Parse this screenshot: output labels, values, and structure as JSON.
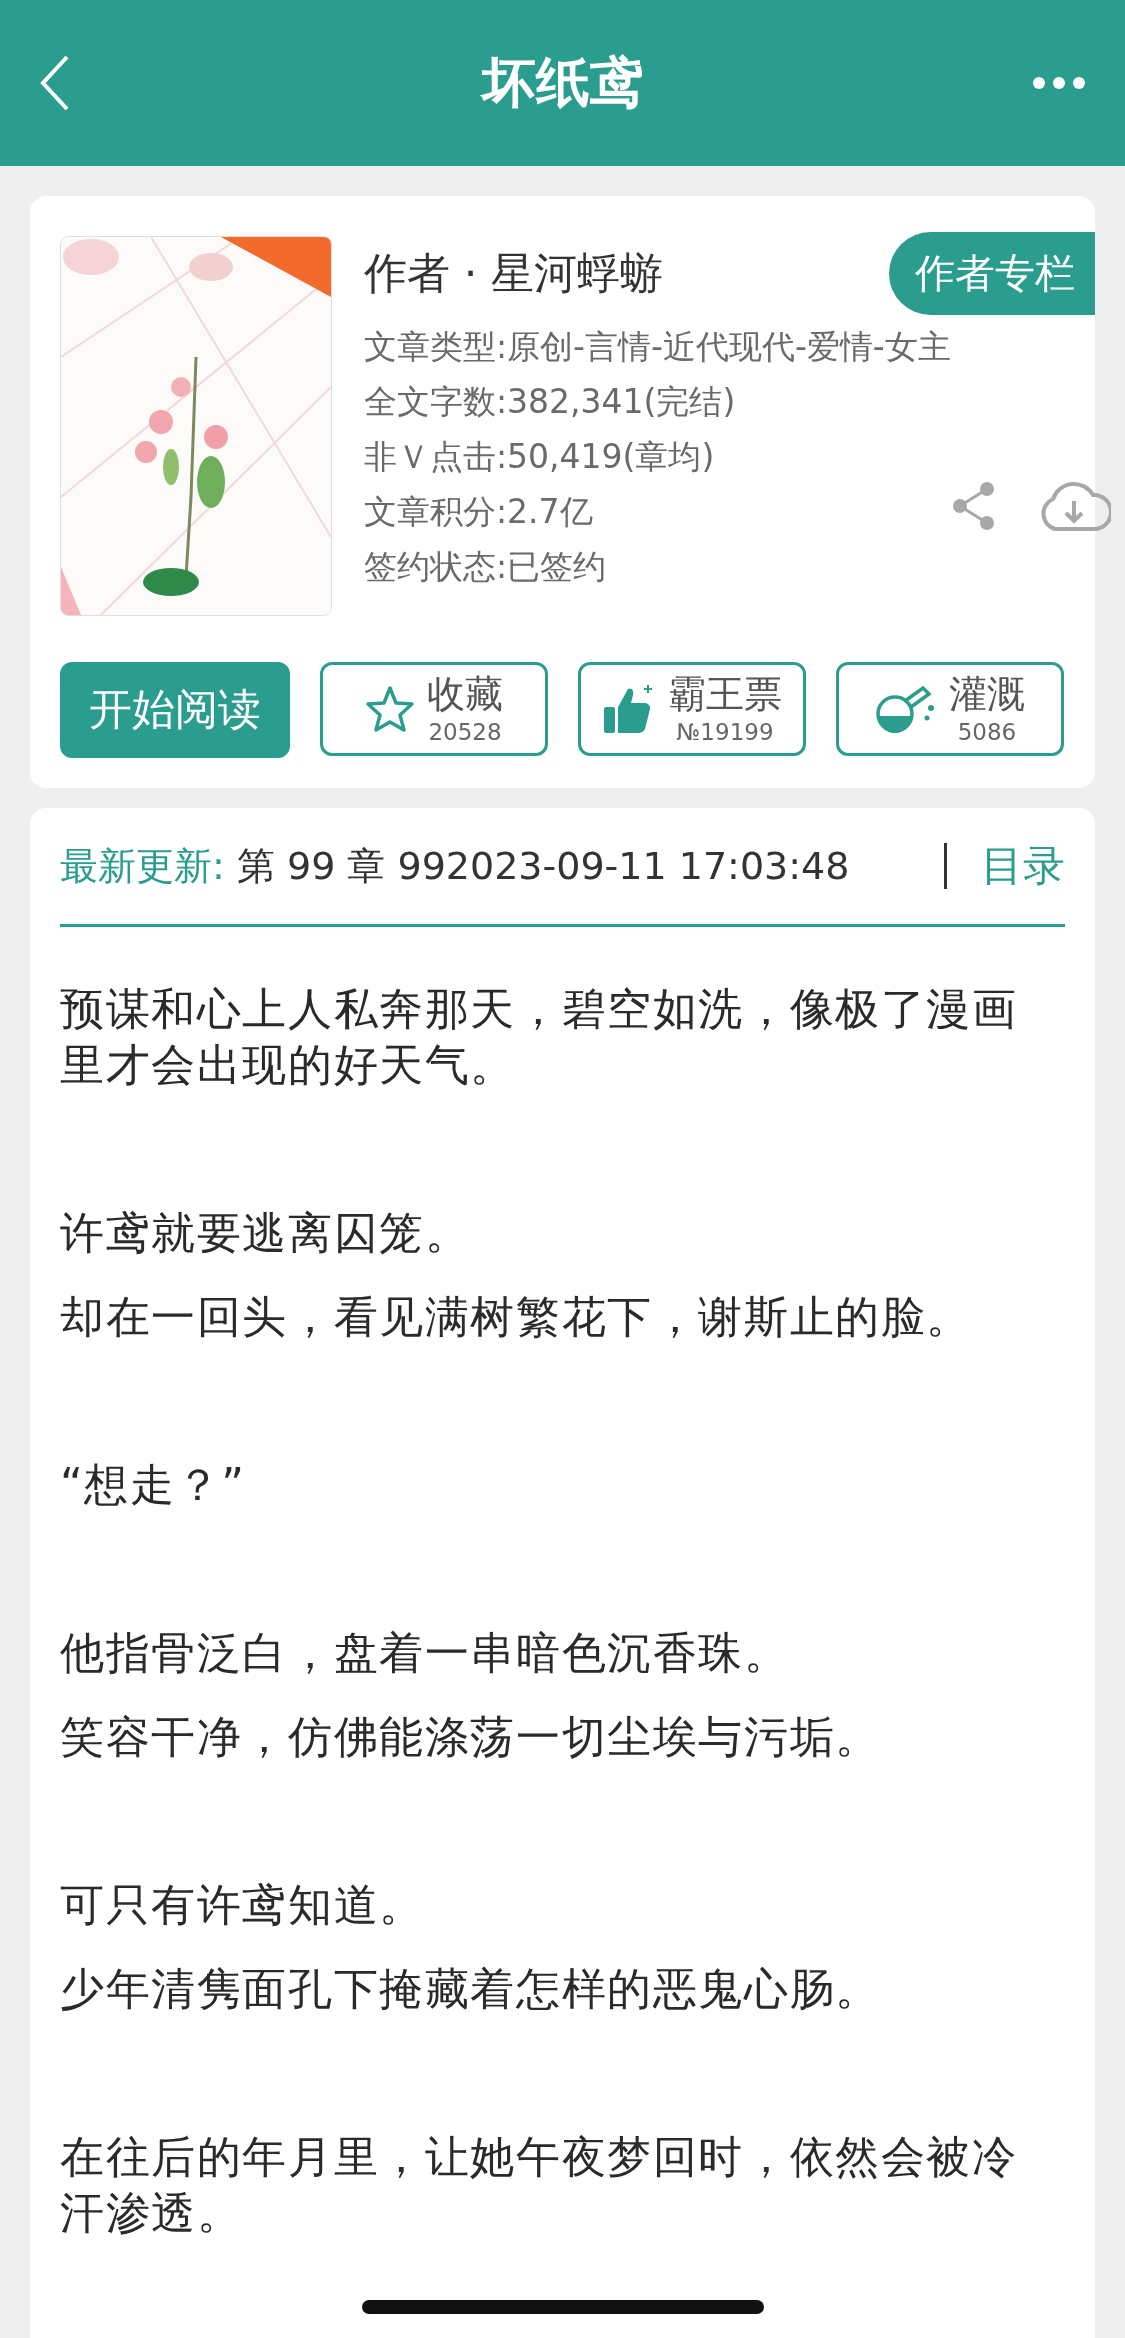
{
  "header": {
    "title": "坏纸鸢"
  },
  "book": {
    "cover": {
      "kind": "picture"
    },
    "author": "作者 · 星河蜉蝣",
    "author_button": "作者专栏",
    "info": [
      "文章类型:原创-言情-近代现代-爱情-女主",
      "全文字数:382,341(完结)",
      "非Ｖ点击:50,419(章均)",
      "文章积分:2.7亿",
      "签约状态:已签约"
    ]
  },
  "actions": [
    {
      "kind": "read",
      "label": "开始阅读"
    },
    {
      "kind": "star",
      "label": "收藏",
      "count": "20528"
    },
    {
      "kind": "thumb",
      "label": "霸王票",
      "count": "№19199"
    },
    {
      "kind": "flask",
      "label": "灌溉",
      "count": "5086"
    }
  ],
  "latest": {
    "label": "最新更新:",
    "value": "第 99 章 992023-09-11 17:03:48",
    "toc": "目录"
  },
  "paragraphs": [
    [
      "预谋和心上人私奔那天，碧空如洗，像极了漫画里才会出现的好天气。"
    ],
    [
      "许鸢就要逃离囚笼。",
      "却在一回头，看见满树繁花下，谢斯止的脸。"
    ],
    [
      "“想走？”"
    ],
    [
      "他指骨泛白，盘着一串暗色沉香珠。",
      "笑容干净，仿佛能涤荡一切尘埃与污垢。"
    ],
    [
      "可只有许鸢知道。",
      "少年清隽面孔下掩藏着怎样的恶鬼心肠。"
    ],
    [
      "在往后的年月里，让她午夜梦回时，依然会被冷汗渗透。"
    ]
  ]
}
